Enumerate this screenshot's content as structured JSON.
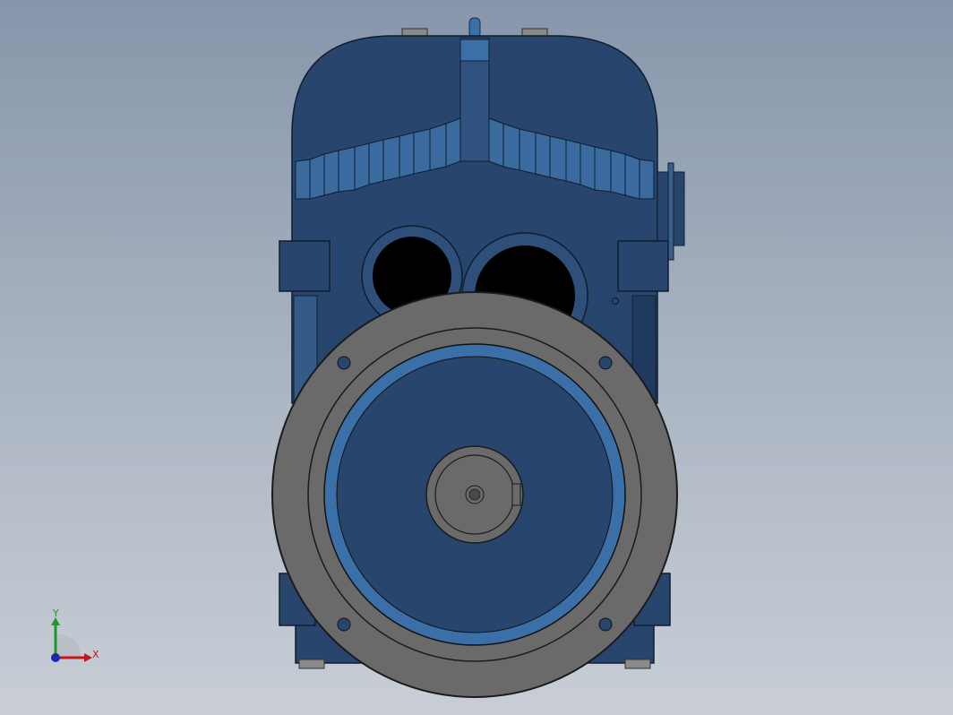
{
  "viewport": {
    "background_top": "#8796ab",
    "background_bottom": "#c9ced6"
  },
  "model": {
    "housing_color": "#28466d",
    "housing_dark": "#1d3556",
    "flange_color": "#6a6a6a",
    "flange_edge": "#2a2a2a",
    "bore_color": "#000000"
  },
  "triad": {
    "x_label": "X",
    "y_label": "Y",
    "x_color": "#c41818",
    "y_color": "#1a9a2a",
    "z_color": "#1a2ab0"
  }
}
